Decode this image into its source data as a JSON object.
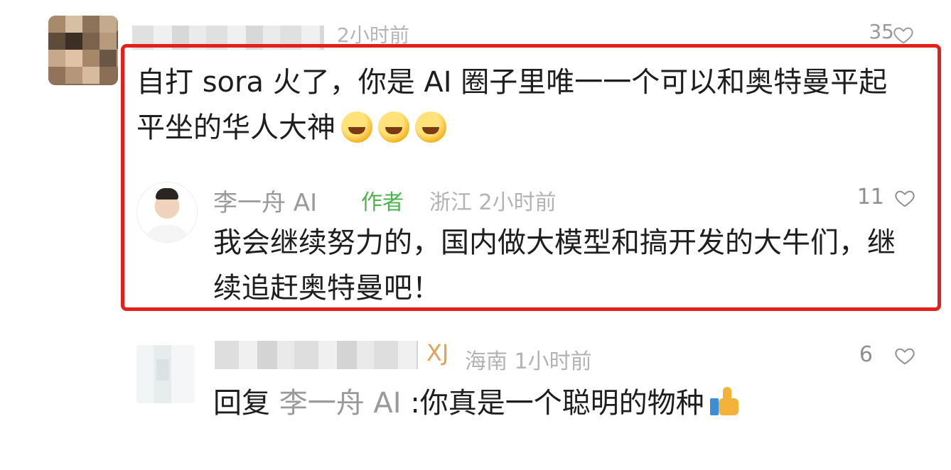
{
  "top_comment": {
    "time": "2小时前",
    "likes": "35",
    "text": "自打 sora 火了，你是 AI 圈子里唯一一个可以和奥特曼平起平坐的华人大神",
    "emoji": [
      "crying-laughing-emoji",
      "crying-laughing-emoji",
      "crying-laughing-emoji"
    ]
  },
  "author_reply": {
    "name": "李一舟 AI",
    "tag": "作者",
    "location_time": "浙江 2小时前",
    "likes": "11",
    "text": "我会继续努力的，国内做大模型和搞开发的大牛们，继续追赶奥特曼吧！"
  },
  "bottom_reply": {
    "badge": "XJ",
    "location_time": "海南 1小时前",
    "likes": "6",
    "prefix": "回复",
    "reply_to": "李一舟 AI",
    "text": ":你真是一个聪明的物种",
    "emoji": "thumbs-up-emoji"
  },
  "colors": {
    "highlight_border": "#e4201c",
    "author_tag": "#4db34d",
    "meta_gray": "#b3b3b3"
  }
}
